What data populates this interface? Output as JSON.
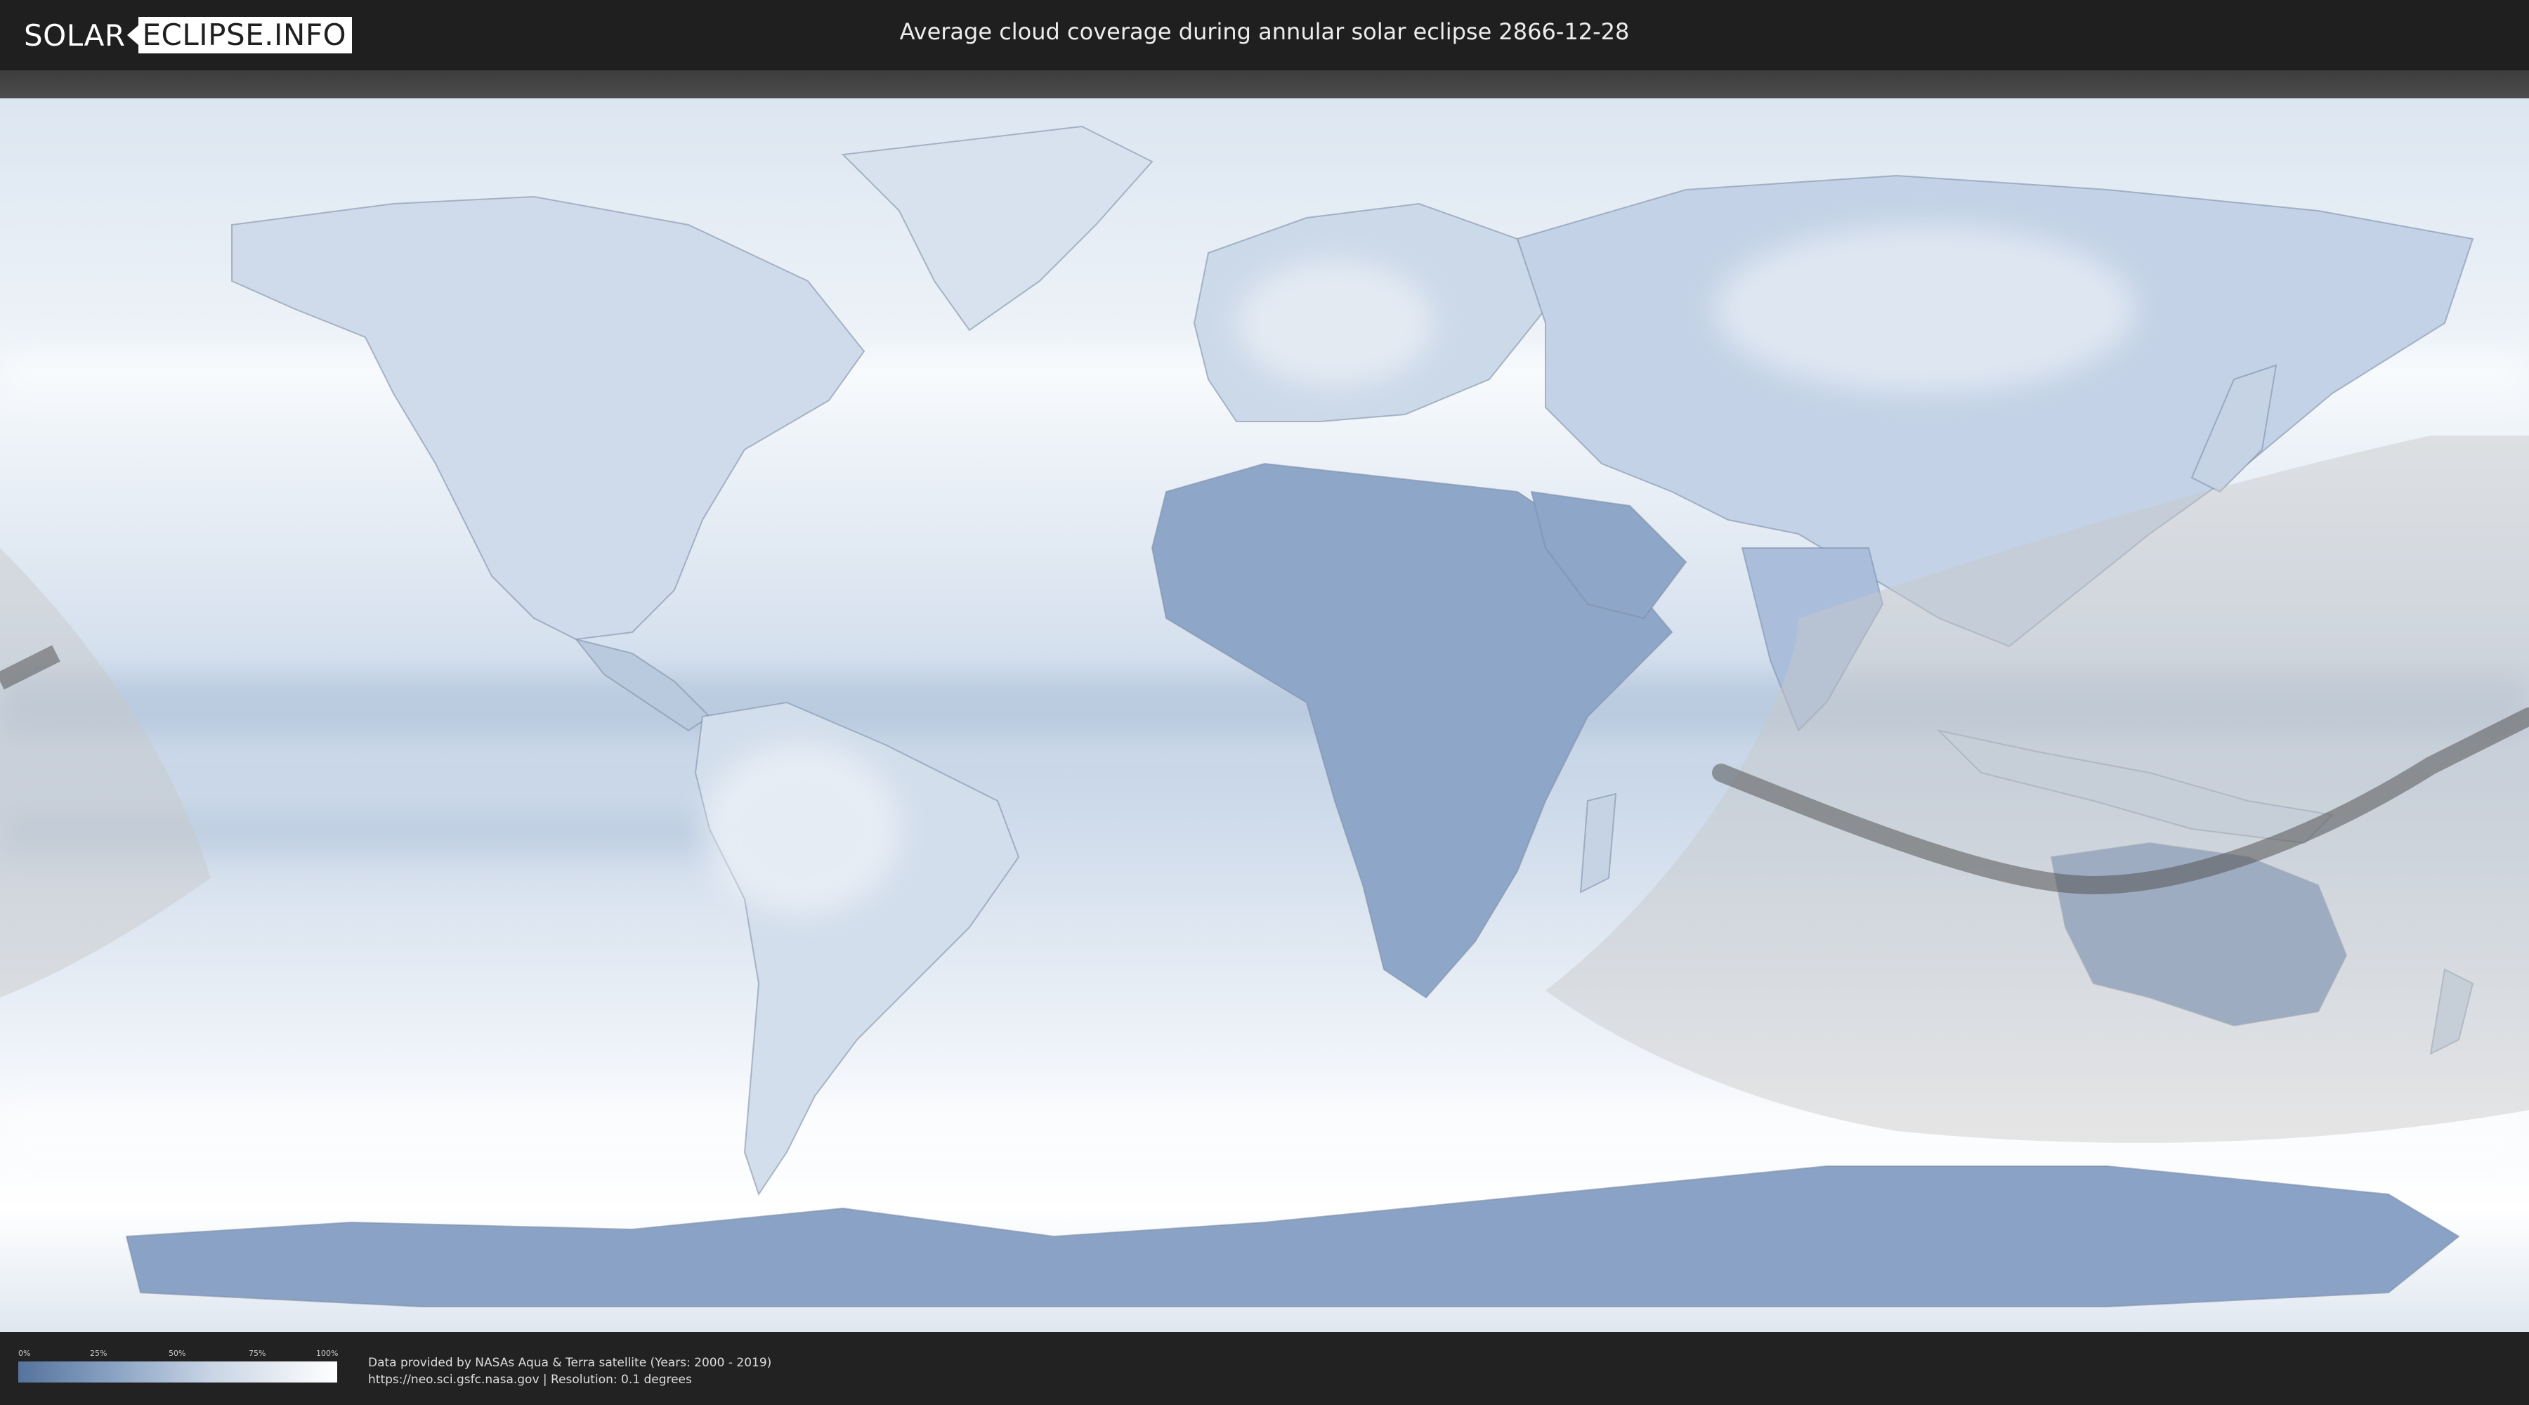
{
  "header": {
    "logo_part1": "SOLAR",
    "logo_part2": "ECLIPSE.INFO",
    "title": "Average cloud coverage during annular solar eclipse 2866-12-28"
  },
  "legend": {
    "ticks": [
      "0%",
      "25%",
      "50%",
      "75%",
      "100%"
    ],
    "color_low": "#55739c",
    "color_high": "#ffffff"
  },
  "credits": {
    "line1": "Data provided by NASAs Aqua & Terra satellite (Years: 2000 - 2019)",
    "line2": "https://neo.sci.gsfc.nasa.gov | Resolution: 0.1 degrees"
  },
  "colors": {
    "ocean_cloud": "#e6edf5",
    "land_clear": "#7d97bd",
    "eclipse_zone": "#c8c8c8",
    "eclipse_path": "#555555"
  }
}
